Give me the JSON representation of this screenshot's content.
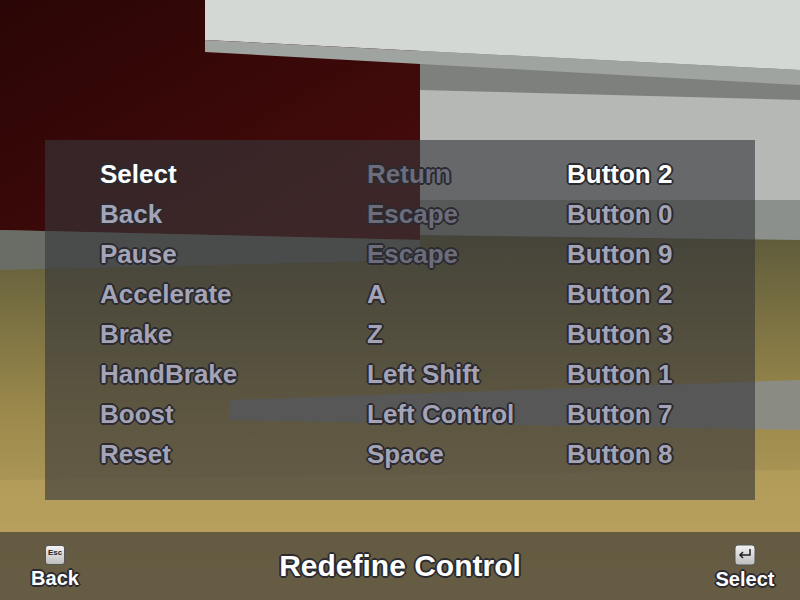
{
  "screen": {
    "title": "Redefine Control"
  },
  "bindings": [
    {
      "action": "Select",
      "key": "Return",
      "key_disabled": true,
      "button": "Button 2",
      "selected": true
    },
    {
      "action": "Back",
      "key": "Escape",
      "key_disabled": true,
      "button": "Button 0",
      "selected": false
    },
    {
      "action": "Pause",
      "key": "Escape",
      "key_disabled": true,
      "button": "Button 9",
      "selected": false
    },
    {
      "action": "Accelerate",
      "key": "A",
      "key_disabled": false,
      "button": "Button 2",
      "selected": false
    },
    {
      "action": "Brake",
      "key": "Z",
      "key_disabled": false,
      "button": "Button 3",
      "selected": false
    },
    {
      "action": "HandBrake",
      "key": "Left Shift",
      "key_disabled": false,
      "button": "Button 1",
      "selected": false
    },
    {
      "action": "Boost",
      "key": "Left Control",
      "key_disabled": false,
      "button": "Button 7",
      "selected": false
    },
    {
      "action": "Reset",
      "key": "Space",
      "key_disabled": false,
      "button": "Button 8",
      "selected": false
    }
  ],
  "footer": {
    "back": {
      "key": "Esc",
      "label": "Back"
    },
    "select": {
      "label": "Select"
    }
  }
}
